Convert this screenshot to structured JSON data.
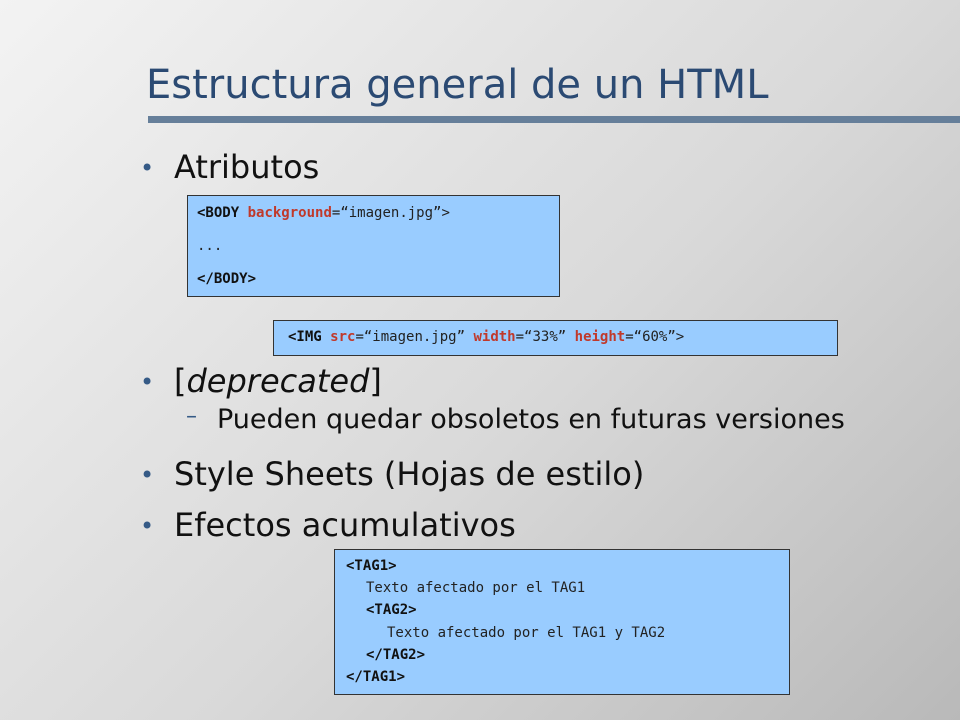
{
  "slide": {
    "title": "Estructura general de un HTML"
  },
  "bullets": {
    "atributos": "Atributos",
    "deprecated_open": "[",
    "deprecated_word": "deprecated",
    "deprecated_close": "]",
    "deprecated_sub": "Pueden quedar obsoletos en futuras versiones",
    "style_sheets": "Style Sheets (Hojas de estilo)",
    "efectos": "Efectos acumulativos",
    "bullet_glyph": "•",
    "dash_glyph": "–"
  },
  "code_body": {
    "open_tag": "<BODY",
    "attr_name": "background",
    "attr_rest": "=“imagen.jpg”>",
    "ellipsis": "...",
    "close_tag": "</BODY>"
  },
  "code_img": {
    "open_tag": "<IMG",
    "src_name": "src",
    "src_val": "=“imagen.jpg”",
    "width_name": "width",
    "width_val": "=“33%”",
    "height_name": "height",
    "height_val": "=“60%”>"
  },
  "code_tags": {
    "tag1_open": "<TAG1>",
    "text1": "Texto afectado por el TAG1",
    "tag2_open": "<TAG2>",
    "text2": "Texto afectado por el TAG1 y TAG2",
    "tag2_close": "</TAG2>",
    "tag1_close": "</TAG1>"
  },
  "colors": {
    "title": "#2b4a73",
    "rule": "#667f9a",
    "code_bg": "#99ccff",
    "attr_red": "#c0392b",
    "bullet_blue": "#355a86"
  }
}
